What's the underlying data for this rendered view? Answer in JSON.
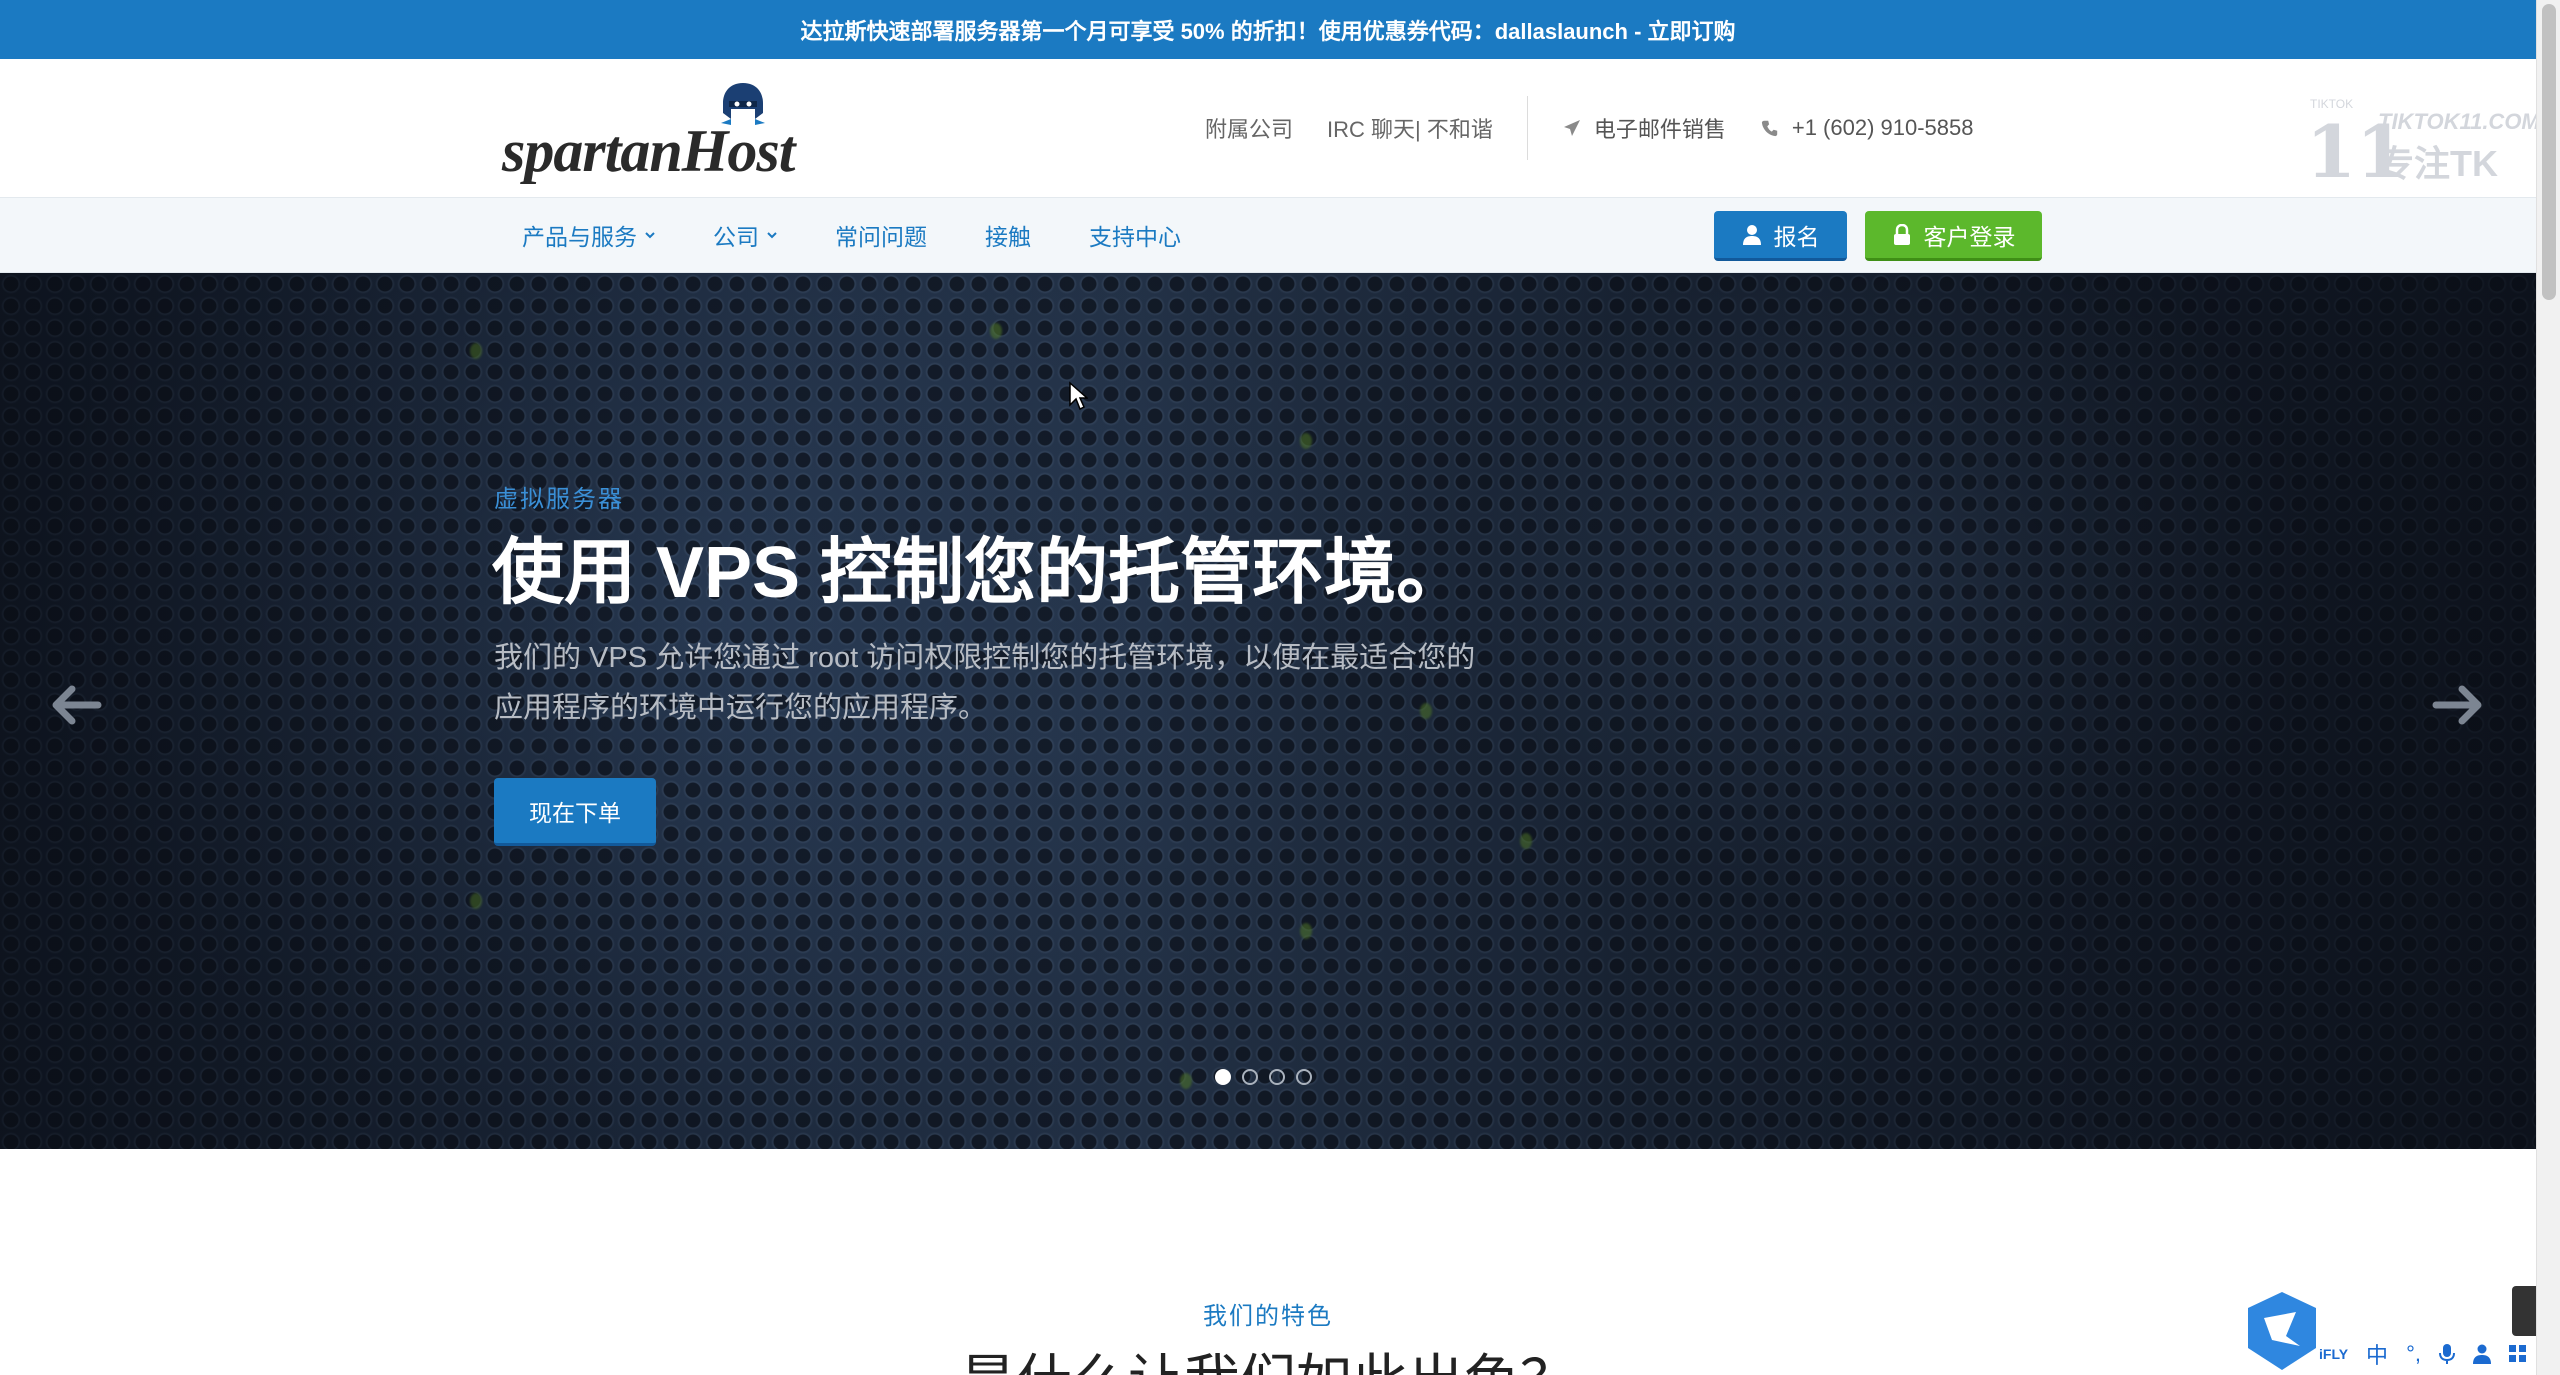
{
  "promo": {
    "text": "达拉斯快速部署服务器第一个月可享受 50% 的折扣！使用优惠券代码：dallaslaunch - 立即订购"
  },
  "header": {
    "logo": {
      "text": "spartanHost",
      "icon": "spartan-helmet-icon"
    },
    "links": [
      {
        "label": "附属公司"
      },
      {
        "label": "IRC 聊天| 不和谐"
      }
    ],
    "email_label": "电子邮件销售",
    "phone_label": "+1 (602) 910-5858"
  },
  "nav": {
    "items": [
      {
        "label": "产品与服务",
        "has_dropdown": true
      },
      {
        "label": "公司",
        "has_dropdown": true
      },
      {
        "label": "常问问题",
        "has_dropdown": false
      },
      {
        "label": "接触",
        "has_dropdown": false
      },
      {
        "label": "支持中心",
        "has_dropdown": false
      }
    ],
    "signup_label": "报名",
    "login_label": "客户登录"
  },
  "hero": {
    "eyebrow": "虚拟服务器",
    "headline": "使用 VPS 控制您的托管环境。",
    "lead": "我们的 VPS 允许您通过 root 访问权限控制您的托管环境，以便在最适合您的应用程序的环境中运行您的应用程序。",
    "cta_label": "现在下单",
    "slides": 4,
    "active_slide": 1
  },
  "features": {
    "kicker": "我们的特色",
    "title": "是什么让我们如此出色？"
  },
  "watermark": {
    "small": "TIKTOK",
    "num": "11",
    "site": "TIKTOK11.COM",
    "brand": "专注TK"
  },
  "ime": {
    "items": [
      "iFLY",
      "中",
      "°,",
      "mic",
      "user",
      "grid"
    ]
  },
  "colors": {
    "brand_blue": "#1b7ac2",
    "login_green": "#5cb82c",
    "hero_dark": "#1d2a3e"
  }
}
